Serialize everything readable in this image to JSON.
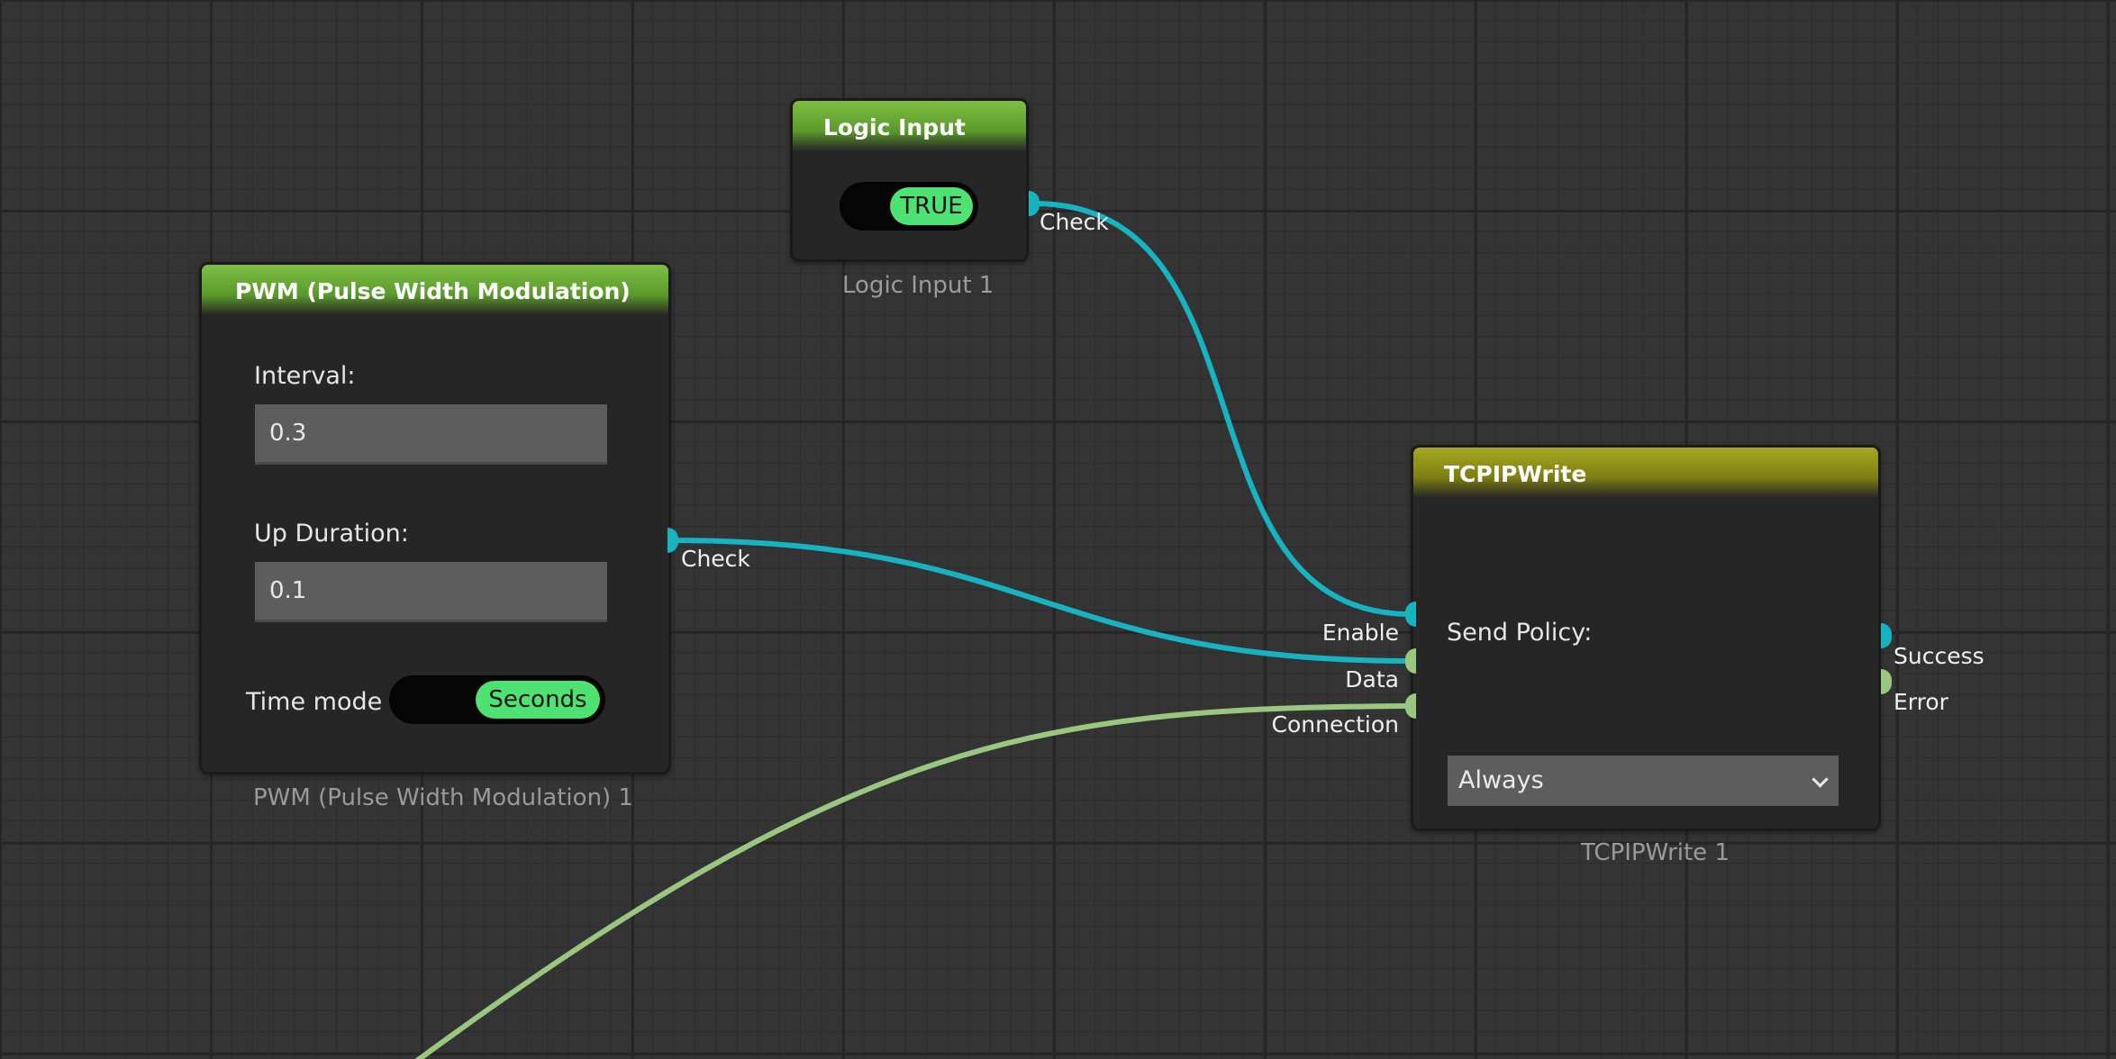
{
  "colors": {
    "canvas_bg": "#343434",
    "node_bg": "#262626",
    "header_green": "#6aaa36",
    "header_yellow": "#929219",
    "toggle_on": "#4de272",
    "wire_teal": "#17b3c0",
    "wire_green": "#9ac77f"
  },
  "nodes": {
    "logic_input": {
      "title": "Logic Input",
      "toggle_value": "TRUE",
      "output_port": "Check",
      "caption": "Logic Input 1"
    },
    "pwm": {
      "title": "PWM (Pulse Width Modulation)",
      "interval_label": "Interval:",
      "interval_value": "0.3",
      "up_duration_label": "Up Duration:",
      "up_duration_value": "0.1",
      "time_mode_label": "Time mode",
      "time_mode_value": "Seconds",
      "output_port": "Check",
      "caption": "PWM (Pulse Width Modulation) 1"
    },
    "tcpip_write": {
      "title": "TCPIPWrite",
      "inputs": {
        "enable": "Enable",
        "data": "Data",
        "connection": "Connection"
      },
      "send_policy_label": "Send Policy:",
      "send_policy_value": "Always",
      "outputs": {
        "success": "Success",
        "error": "Error"
      },
      "caption": "TCPIPWrite 1"
    }
  }
}
